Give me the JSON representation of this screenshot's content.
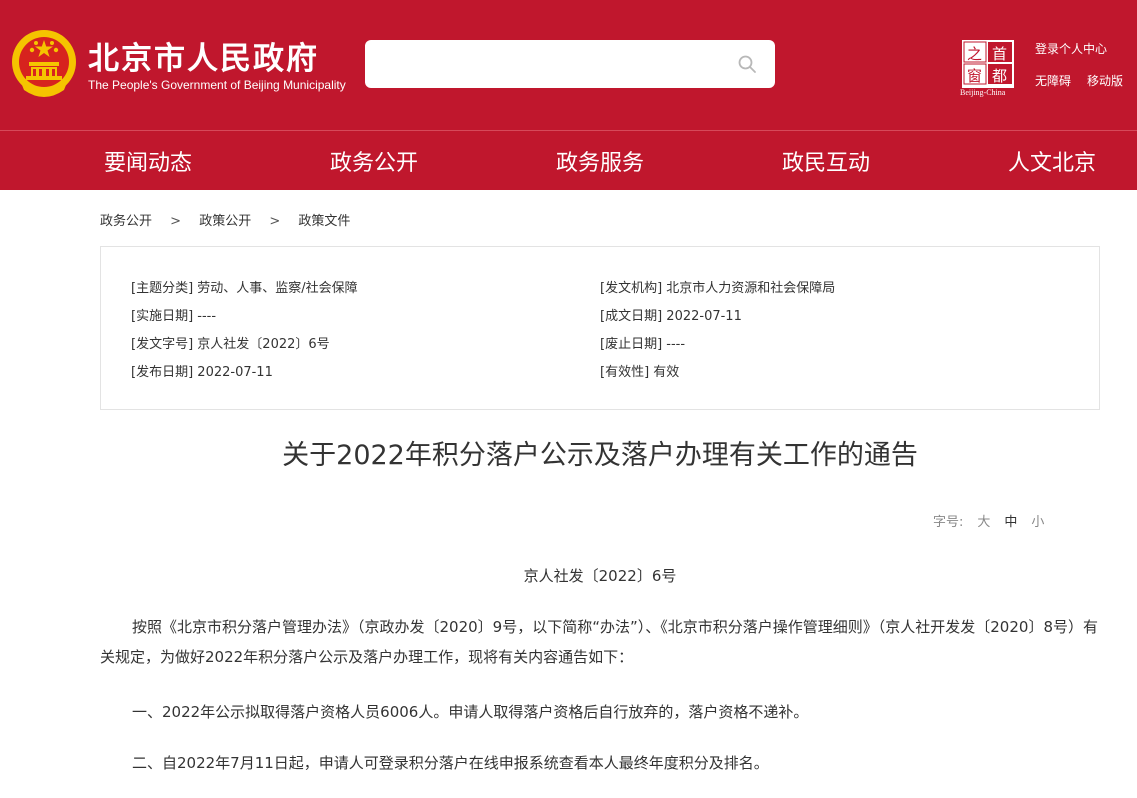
{
  "header": {
    "site_title": "北京市人民政府",
    "site_subtitle": "The People's Government of Beijing Municipality",
    "search_placeholder": "",
    "links": {
      "login": "登录个人中心",
      "accessibility": "无障碍",
      "mobile": "移动版"
    },
    "capital_logo": {
      "chars": [
        "之",
        "首",
        "窗",
        "都"
      ],
      "caption": "Beijing-China"
    },
    "colors": {
      "brand_red": "#c0172d",
      "emblem_gold": "#f5c400"
    }
  },
  "nav": [
    "要闻动态",
    "政务公开",
    "政务服务",
    "政民互动",
    "人文北京"
  ],
  "breadcrumb": [
    "政务公开",
    "政策公开",
    "政策文件"
  ],
  "breadcrumb_sep": ">",
  "meta": {
    "left": [
      {
        "label": "[主题分类]",
        "value": "劳动、人事、监察/社会保障"
      },
      {
        "label": "[实施日期]",
        "value": "----"
      },
      {
        "label": "[发文字号]",
        "value": "京人社发〔2022〕6号"
      },
      {
        "label": "[发布日期]",
        "value": "2022-07-11"
      }
    ],
    "right": [
      {
        "label": "[发文机构]",
        "value": "北京市人力资源和社会保障局"
      },
      {
        "label": "[成文日期]",
        "value": "2022-07-11"
      },
      {
        "label": "[废止日期]",
        "value": "----"
      },
      {
        "label": "[有效性]",
        "value": "有效"
      }
    ]
  },
  "document": {
    "title": "关于2022年积分落户公示及落户办理有关工作的通告",
    "font_size_label": "字号:",
    "font_size_options": [
      "大",
      "中",
      "小"
    ],
    "font_size_selected": "中",
    "doc_number": "京人社发〔2022〕6号",
    "paragraphs": [
      "按照《北京市积分落户管理办法》（京政办发〔2020〕9号，以下简称“办法”）、《北京市积分落户操作管理细则》（京人社开发发〔2020〕8号）有关规定，为做好2022年积分落户公示及落户办理工作，现将有关内容通告如下：",
      "一、2022年公示拟取得落户资格人员6006人。申请人取得落户资格后自行放弃的，落户资格不递补。",
      "二、自2022年7月11日起，申请人可登录积分落户在线申报系统查看本人最终年度积分及排名。"
    ]
  }
}
